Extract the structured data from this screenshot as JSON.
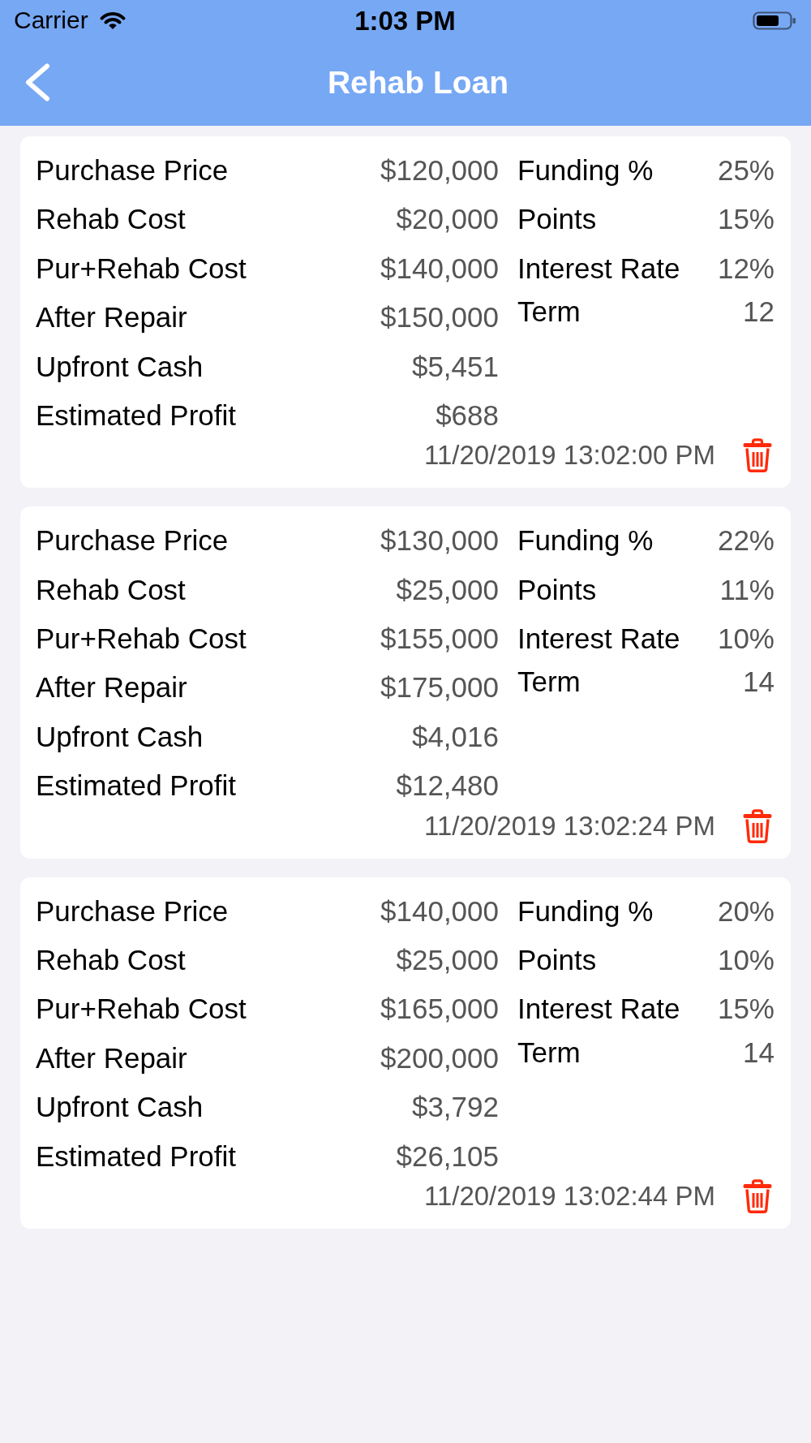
{
  "status_bar": {
    "carrier": "Carrier",
    "time": "1:03 PM"
  },
  "nav_bar": {
    "title": "Rehab Loan"
  },
  "loans": [
    {
      "details": [
        {
          "label": "Purchase Price",
          "value": "$120,000"
        },
        {
          "label": "Rehab Cost",
          "value": "$20,000"
        },
        {
          "label": "Pur+Rehab Cost",
          "value": "$140,000"
        },
        {
          "label": "After Repair",
          "value": "$150,000"
        },
        {
          "label": "Upfront Cash",
          "value": "$5,451"
        },
        {
          "label": "Estimated Profit",
          "value": "$688"
        }
      ],
      "terms": [
        {
          "label": "Funding %",
          "value": "25%"
        },
        {
          "label": "Points",
          "value": "15%"
        },
        {
          "label": "Interest Rate",
          "value": "12%"
        },
        {
          "label": "Term",
          "value": "12"
        }
      ],
      "timestamp": "11/20/2019 13:02:00 PM"
    },
    {
      "details": [
        {
          "label": "Purchase Price",
          "value": "$130,000"
        },
        {
          "label": "Rehab Cost",
          "value": "$25,000"
        },
        {
          "label": "Pur+Rehab Cost",
          "value": "$155,000"
        },
        {
          "label": "After Repair",
          "value": "$175,000"
        },
        {
          "label": "Upfront Cash",
          "value": "$4,016"
        },
        {
          "label": "Estimated Profit",
          "value": "$12,480"
        }
      ],
      "terms": [
        {
          "label": "Funding %",
          "value": "22%"
        },
        {
          "label": "Points",
          "value": "11%"
        },
        {
          "label": "Interest Rate",
          "value": "10%"
        },
        {
          "label": "Term",
          "value": "14"
        }
      ],
      "timestamp": "11/20/2019 13:02:24 PM"
    },
    {
      "details": [
        {
          "label": "Purchase Price",
          "value": "$140,000"
        },
        {
          "label": "Rehab Cost",
          "value": "$25,000"
        },
        {
          "label": "Pur+Rehab Cost",
          "value": "$165,000"
        },
        {
          "label": "After Repair",
          "value": "$200,000"
        },
        {
          "label": "Upfront Cash",
          "value": "$3,792"
        },
        {
          "label": "Estimated Profit",
          "value": "$26,105"
        }
      ],
      "terms": [
        {
          "label": "Funding %",
          "value": "20%"
        },
        {
          "label": "Points",
          "value": "10%"
        },
        {
          "label": "Interest Rate",
          "value": "15%"
        },
        {
          "label": "Term",
          "value": "14"
        }
      ],
      "timestamp": "11/20/2019 13:02:44 PM"
    }
  ]
}
